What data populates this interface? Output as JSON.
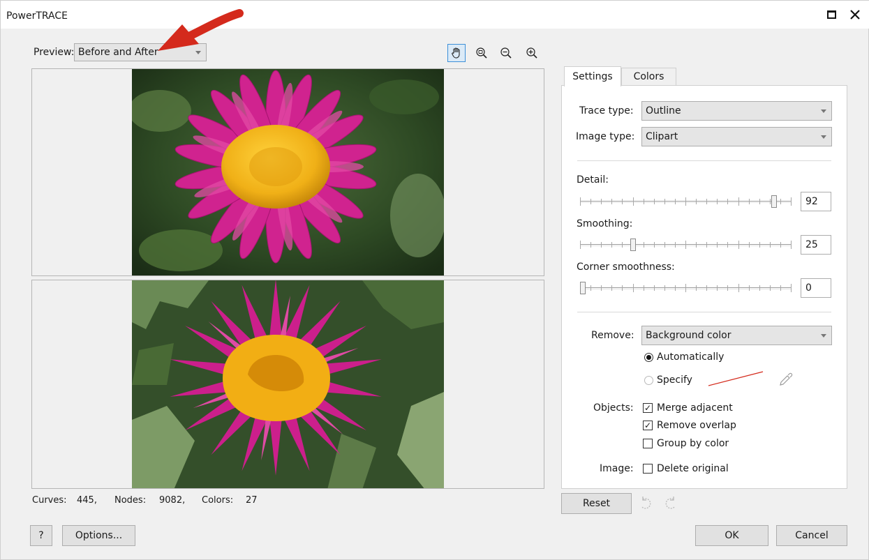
{
  "window": {
    "title": "PowerTRACE"
  },
  "preview": {
    "label": "Preview:",
    "mode": "Before and After"
  },
  "toolbar": {
    "tools": [
      "pan-hand-icon",
      "zoom-to-fit-icon",
      "zoom-out-icon",
      "zoom-in-icon"
    ],
    "active_tool": "pan-hand-icon"
  },
  "stats": {
    "curves_label": "Curves:",
    "curves": "445,",
    "nodes_label": "Nodes:",
    "nodes": "9082,",
    "colors_label": "Colors:",
    "colors": "27"
  },
  "tabs": [
    {
      "label": "Settings",
      "active": true
    },
    {
      "label": "Colors",
      "active": false
    }
  ],
  "settings": {
    "trace_type_label": "Trace type:",
    "trace_type": "Outline",
    "image_type_label": "Image type:",
    "image_type": "Clipart",
    "detail_label": "Detail:",
    "detail": "92",
    "smoothing_label": "Smoothing:",
    "smoothing": "25",
    "corner_label": "Corner smoothness:",
    "corner": "0",
    "remove_label": "Remove:",
    "remove": "Background color",
    "auto_label": "Automatically",
    "specify_label": "Specify",
    "objects_label": "Objects:",
    "merge_label": "Merge adjacent",
    "merge_checked": true,
    "overlap_label": "Remove overlap",
    "overlap_checked": true,
    "group_label": "Group by color",
    "group_checked": false,
    "image_label": "Image:",
    "delete_label": "Delete original",
    "delete_checked": false
  },
  "buttons": {
    "reset": "Reset",
    "help": "?",
    "options": "Options...",
    "ok": "OK",
    "cancel": "Cancel"
  },
  "colors": {
    "accent": "#3c8fd8",
    "annotation_arrow": "#d42a1c",
    "flower_petal": "#d0238f",
    "flower_center": "#f0b017",
    "foliage": "#3d5a2e"
  }
}
